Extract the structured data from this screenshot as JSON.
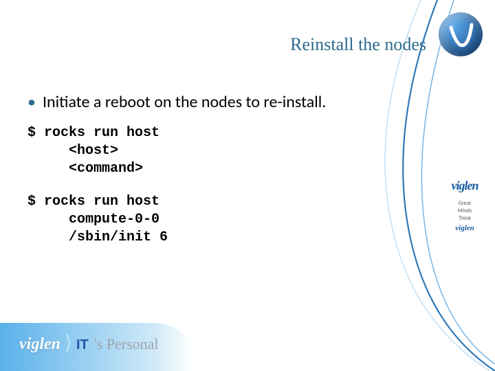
{
  "title": "Reinstall the nodes",
  "bullet": "Initiate a reboot on the nodes to re-install.",
  "code1": {
    "l1": "$ rocks run host",
    "l2": "<host>",
    "l3": "<command>"
  },
  "code2": {
    "l1": "$ rocks run host",
    "l2": "compute-0-0",
    "l3": "/sbin/init 6"
  },
  "brand": {
    "name": "viglen",
    "tag1": "Great",
    "tag2": "Minds",
    "tag3": "Think",
    "small": "viglen"
  },
  "footer": {
    "brand": "viglen",
    "it": "IT",
    "tag": "'s Personal"
  }
}
